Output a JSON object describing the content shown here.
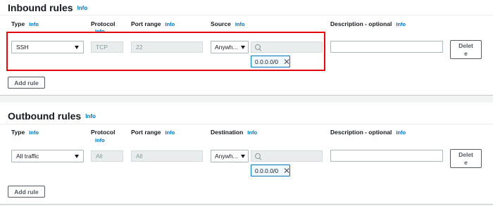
{
  "inbound": {
    "title": "Inbound rules",
    "info": "Info",
    "columns": {
      "type": "Type",
      "protocol": "Protocol",
      "port_range": "Port range",
      "source": "Source",
      "description": "Description - optional",
      "info": "Info"
    },
    "rule": {
      "type": "SSH",
      "protocol": "TCP",
      "port_range": "22",
      "source": "Anywh...",
      "cidr": "0.0.0.0/0",
      "description": "",
      "delete_label": "Delete"
    },
    "add_rule_label": "Add rule"
  },
  "outbound": {
    "title": "Outbound rules",
    "info": "Info",
    "columns": {
      "type": "Type",
      "protocol": "Protocol",
      "port_range": "Port range",
      "destination": "Destination",
      "description": "Description - optional",
      "info": "Info"
    },
    "rule": {
      "type": "All traffic",
      "protocol": "All",
      "port_range": "All",
      "destination": "Anywh...",
      "cidr": "0.0.0.0/0",
      "description": "",
      "delete_label": "Delete"
    },
    "add_rule_label": "Add rule"
  },
  "colors": {
    "link": "#0073bb",
    "highlight": "#e5050a",
    "token_border": "#0073bb"
  }
}
